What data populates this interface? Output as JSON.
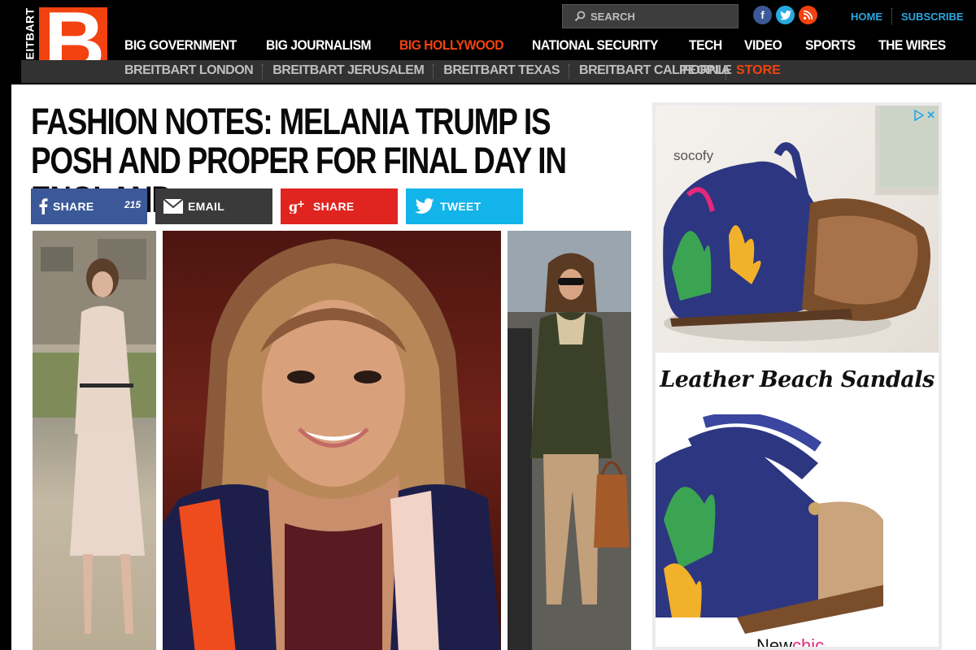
{
  "logo": {
    "vertical_text": "BREITBART",
    "letter": "B"
  },
  "search": {
    "placeholder": "SEARCH"
  },
  "social": {
    "facebook": "f",
    "twitter": "t",
    "rss": "rss"
  },
  "top_links": {
    "home": "HOME",
    "subscribe": "SUBSCRIBE"
  },
  "nav_main": [
    {
      "label": "BIG GOVERNMENT"
    },
    {
      "label": "BIG JOURNALISM"
    },
    {
      "label": "BIG HOLLYWOOD",
      "active": true
    },
    {
      "label": "NATIONAL SECURITY"
    },
    {
      "label": "TECH"
    },
    {
      "label": "VIDEO"
    },
    {
      "label": "SPORTS"
    },
    {
      "label": "THE WIRES"
    }
  ],
  "nav_sub": [
    {
      "label": "BREITBART LONDON"
    },
    {
      "label": "BREITBART JERUSALEM"
    },
    {
      "label": "BREITBART TEXAS"
    },
    {
      "label": "BREITBART CALIFORNIA"
    }
  ],
  "nav_right": {
    "people": "PEOPLE",
    "store": "STORE"
  },
  "article": {
    "title": "FASHION NOTES: MELANIA TRUMP IS POSH AND PROPER FOR FINAL DAY IN ENGLAND"
  },
  "share": {
    "facebook_label": "SHARE",
    "facebook_count": "215",
    "email_label": "EMAIL",
    "googleplus_label": "SHARE",
    "twitter_label": "TWEET"
  },
  "ad": {
    "brand": "socofy",
    "headline": "Leather Beach Sandals",
    "footer_a": "New",
    "footer_b": "chic"
  },
  "colors": {
    "brand_orange": "#f2420f",
    "link_blue": "#2aa6e2",
    "facebook": "#3b5998",
    "googleplus": "#e0241f",
    "twitter": "#12b4ea"
  }
}
